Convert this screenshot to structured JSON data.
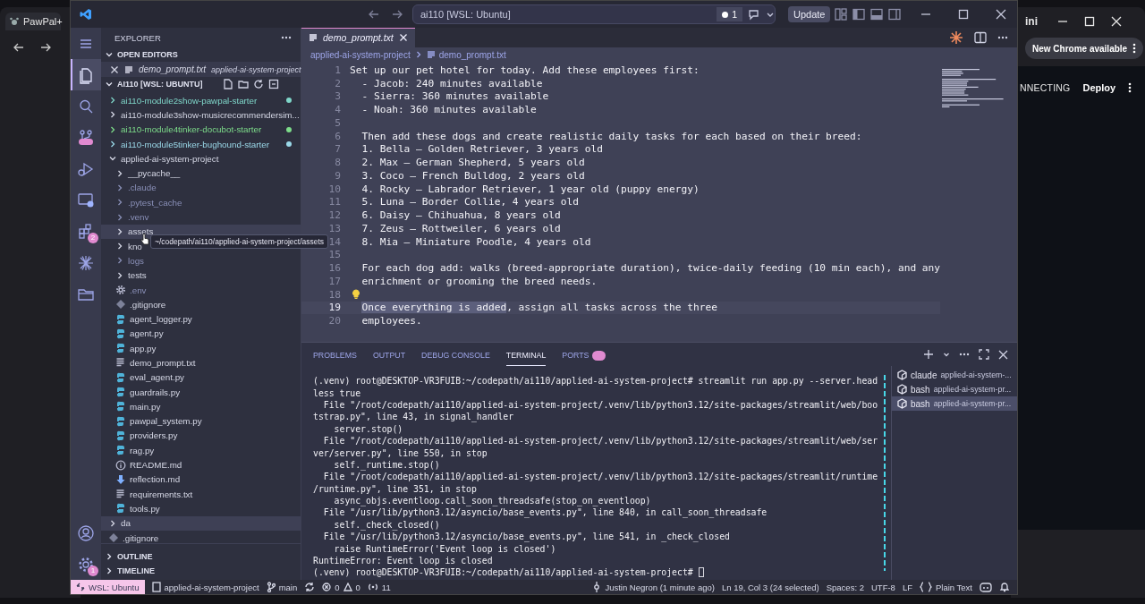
{
  "background_windows": {
    "left_browser": {
      "tab_title": "PawPal+"
    },
    "right_browser": {
      "title": "ini",
      "update_button": "New Chrome available",
      "status": "NNECTING",
      "deploy_button": "Deploy"
    }
  },
  "window": {
    "command_center": "ai110 [WSL: Ubuntu]",
    "notification_count": "1",
    "update_button": "Update"
  },
  "activity_bar": {
    "top": [
      {
        "kind": "menu",
        "selected": false
      },
      {
        "kind": "explorer",
        "selected": true
      },
      {
        "kind": "search",
        "selected": false
      },
      {
        "kind": "source_control",
        "selected": false
      },
      {
        "kind": "run",
        "selected": false
      },
      {
        "kind": "remote",
        "selected": false
      },
      {
        "kind": "extensions",
        "selected": false,
        "badge": "2"
      },
      {
        "kind": "spark",
        "selected": false
      },
      {
        "kind": "folder",
        "selected": false
      }
    ],
    "bottom": [
      {
        "kind": "account",
        "selected": false
      },
      {
        "kind": "settings",
        "selected": false,
        "badge": "1"
      }
    ]
  },
  "sidebar": {
    "title": "EXPLORER",
    "open_editors": {
      "title": "OPEN EDITORS",
      "expanded": true,
      "items": [
        {
          "name": "demo_prompt.txt",
          "description": "applied-ai-system-project"
        }
      ]
    },
    "workspace": {
      "title": "AI110 [WSL: UBUNTU]",
      "expanded": true,
      "tree": [
        {
          "name": "ai110-module2show-pawpal-starter",
          "kind": "folder",
          "expanded": false,
          "color": "#7fd6c9",
          "ignored": false,
          "selected": false
        },
        {
          "name": "ai110-module3show-musicrecommendersim...",
          "kind": "folder",
          "expanded": false,
          "ignored": false,
          "selected": false
        },
        {
          "name": "ai110-module4tinker-docubot-starter",
          "kind": "folder",
          "expanded": false,
          "color": "#7ddc8a",
          "ignored": false,
          "selected": false
        },
        {
          "name": "ai110-module5tinker-bughound-starter",
          "kind": "folder",
          "expanded": false,
          "color": "#9ad8e8",
          "ignored": false,
          "selected": false
        },
        {
          "name": "applied-ai-system-project",
          "kind": "folder",
          "expanded": true,
          "ignored": false,
          "selected": false,
          "children": [
            {
              "name": "__pycache__",
              "kind": "folder",
              "expanded": false,
              "ignored": false,
              "selected": false
            },
            {
              "name": ".claude",
              "kind": "folder",
              "expanded": false,
              "ignored": true,
              "selected": false
            },
            {
              "name": ".pytest_cache",
              "kind": "folder",
              "expanded": false,
              "ignored": true,
              "selected": false
            },
            {
              "name": ".venv",
              "kind": "folder",
              "expanded": false,
              "ignored": true,
              "selected": false
            },
            {
              "name": "assets",
              "kind": "folder",
              "expanded": false,
              "ignored": false,
              "selected": true
            },
            {
              "name": "kno",
              "kind": "folder",
              "expanded": false,
              "ignored": false,
              "selected": false
            },
            {
              "name": "logs",
              "kind": "folder",
              "expanded": false,
              "ignored": true,
              "selected": false
            },
            {
              "name": "tests",
              "kind": "folder",
              "expanded": false,
              "ignored": false,
              "selected": false
            },
            {
              "name": ".env",
              "kind": "env",
              "ignored": true,
              "selected": false
            },
            {
              "name": ".gitignore",
              "kind": "git",
              "ignored": false,
              "selected": false
            },
            {
              "name": "agent_logger.py",
              "kind": "python",
              "ignored": false,
              "selected": false
            },
            {
              "name": "agent.py",
              "kind": "python",
              "ignored": false,
              "selected": false
            },
            {
              "name": "app.py",
              "kind": "python",
              "ignored": false,
              "selected": false
            },
            {
              "name": "demo_prompt.txt",
              "kind": "text",
              "ignored": false,
              "selected": false
            },
            {
              "name": "eval_agent.py",
              "kind": "python",
              "ignored": false,
              "selected": false
            },
            {
              "name": "guardrails.py",
              "kind": "python",
              "ignored": false,
              "selected": false
            },
            {
              "name": "main.py",
              "kind": "python",
              "ignored": false,
              "selected": false
            },
            {
              "name": "pawpal_system.py",
              "kind": "python",
              "ignored": false,
              "selected": false
            },
            {
              "name": "providers.py",
              "kind": "python",
              "ignored": false,
              "selected": false
            },
            {
              "name": "rag.py",
              "kind": "python",
              "ignored": false,
              "selected": false
            },
            {
              "name": "README.md",
              "kind": "readme",
              "ignored": false,
              "selected": false
            },
            {
              "name": "reflection.md",
              "kind": "markdown",
              "ignored": false,
              "selected": false
            },
            {
              "name": "requirements.txt",
              "kind": "text",
              "ignored": false,
              "selected": false
            },
            {
              "name": "tools.py",
              "kind": "python",
              "ignored": false,
              "selected": false
            }
          ]
        },
        {
          "name": "da",
          "kind": "folder",
          "expanded": false,
          "ignored": false,
          "selected": true
        },
        {
          "name": ".gitignore",
          "kind": "git",
          "ignored": false,
          "selected": false
        }
      ]
    },
    "collapsed_sections": [
      {
        "title": "OUTLINE",
        "expanded": false
      },
      {
        "title": "TIMELINE",
        "expanded": false
      }
    ]
  },
  "tooltip": "~/codepath/ai110/applied-ai-system-project/assets",
  "editor": {
    "tabs": [
      {
        "label": "demo_prompt.txt",
        "selected": true
      }
    ],
    "breadcrumbs": [
      "applied-ai-system-project",
      "demo_prompt.txt"
    ],
    "lines": [
      {
        "number": "1",
        "text": "Set up our pet hotel for today. Add these employees first:"
      },
      {
        "number": "2",
        "text": "  - Jacob: 240 minutes available"
      },
      {
        "number": "3",
        "text": "  - Sierra: 360 minutes available"
      },
      {
        "number": "4",
        "text": "  - Noah: 360 minutes available"
      },
      {
        "number": "5"
      },
      {
        "number": "6",
        "text": "  Then add these dogs and create realistic daily tasks for each based on their breed:"
      },
      {
        "number": "7",
        "text": "  1. Bella — Golden Retriever, 3 years old"
      },
      {
        "number": "8",
        "text": "  2. Max — German Shepherd, 5 years old"
      },
      {
        "number": "9",
        "text": "  3. Coco — French Bulldog, 2 years old"
      },
      {
        "number": "10",
        "text": "  4. Rocky — Labrador Retriever, 1 year old (puppy energy)"
      },
      {
        "number": "11",
        "text": "  5. Luna — Border Collie, 4 years old"
      },
      {
        "number": "12",
        "text": "  6. Daisy — Chihuahua, 8 years old"
      },
      {
        "number": "13",
        "text": "  7. Zeus — Rottweiler, 6 years old"
      },
      {
        "number": "14",
        "text": "  8. Mia — Miniature Poodle, 4 years old"
      },
      {
        "number": "15"
      },
      {
        "number": "16",
        "text": "  For each dog add: walks (breed-appropriate duration), twice-daily feeding (10 min each), and any"
      },
      {
        "number": "17",
        "text": "  enrichment or grooming the breed needs."
      },
      {
        "number": "18",
        "lightbulb": true
      },
      {
        "number": "19",
        "current": true,
        "indent": true,
        "segments": [
          {
            "text": "Once everything is added",
            "selected": true
          },
          {
            "text": ", assign all tasks across the three",
            "selected": false
          }
        ]
      },
      {
        "number": "20",
        "text": "  employees."
      }
    ]
  },
  "panel": {
    "tabs": [
      {
        "label": "PROBLEMS",
        "selected": false
      },
      {
        "label": "OUTPUT",
        "selected": false
      },
      {
        "label": "DEBUG CONSOLE",
        "selected": false
      },
      {
        "label": "TERMINAL",
        "selected": true
      },
      {
        "label": "PORTS",
        "selected": false,
        "badge": true
      }
    ],
    "terminal_lines": [
      "(.venv) root@DESKTOP-VR3FUIB:~/codepath/ai110/applied-ai-system-project# streamlit run app.py --server.head",
      "less true",
      "  File \"/root/codepath/ai110/applied-ai-system-project/.venv/lib/python3.12/site-packages/streamlit/web/boo",
      "tstrap.py\", line 43, in signal_handler",
      "    server.stop()",
      "  File \"/root/codepath/ai110/applied-ai-system-project/.venv/lib/python3.12/site-packages/streamlit/web/ser",
      "ver/server.py\", line 550, in stop",
      "    self._runtime.stop()",
      "  File \"/root/codepath/ai110/applied-ai-system-project/.venv/lib/python3.12/site-packages/streamlit/runtime",
      "/runtime.py\", line 351, in stop",
      "    async_objs.eventloop.call_soon_threadsafe(stop_on_eventloop)",
      "  File \"/usr/lib/python3.12/asyncio/base_events.py\", line 840, in call_soon_threadsafe",
      "    self._check_closed()",
      "  File \"/usr/lib/python3.12/asyncio/base_events.py\", line 541, in _check_closed",
      "    raise RuntimeError('Event loop is closed')",
      "RuntimeError: Event loop is closed",
      "(.venv) root@DESKTOP-VR3FUIB:~/codepath/ai110/applied-ai-system-project# "
    ],
    "cursor": true,
    "terminals": [
      {
        "name": "claude",
        "path": "applied-ai-system-...",
        "selected": false
      },
      {
        "name": "bash",
        "path": "applied-ai-system-pr...",
        "selected": false
      },
      {
        "name": "bash",
        "path": "applied-ai-system-pr...",
        "selected": true
      }
    ]
  },
  "status_bar": {
    "remote": "WSL: Ubuntu",
    "folder": "applied-ai-system-project",
    "branch": "main",
    "errors": "0",
    "warnings": "0",
    "ports": "11",
    "right": [
      "Justin Negron (1 minute ago)",
      "Ln 19, Col 3 (24 selected)",
      "Spaces: 2",
      "UTF-8",
      "LF",
      "Plain Text"
    ]
  }
}
